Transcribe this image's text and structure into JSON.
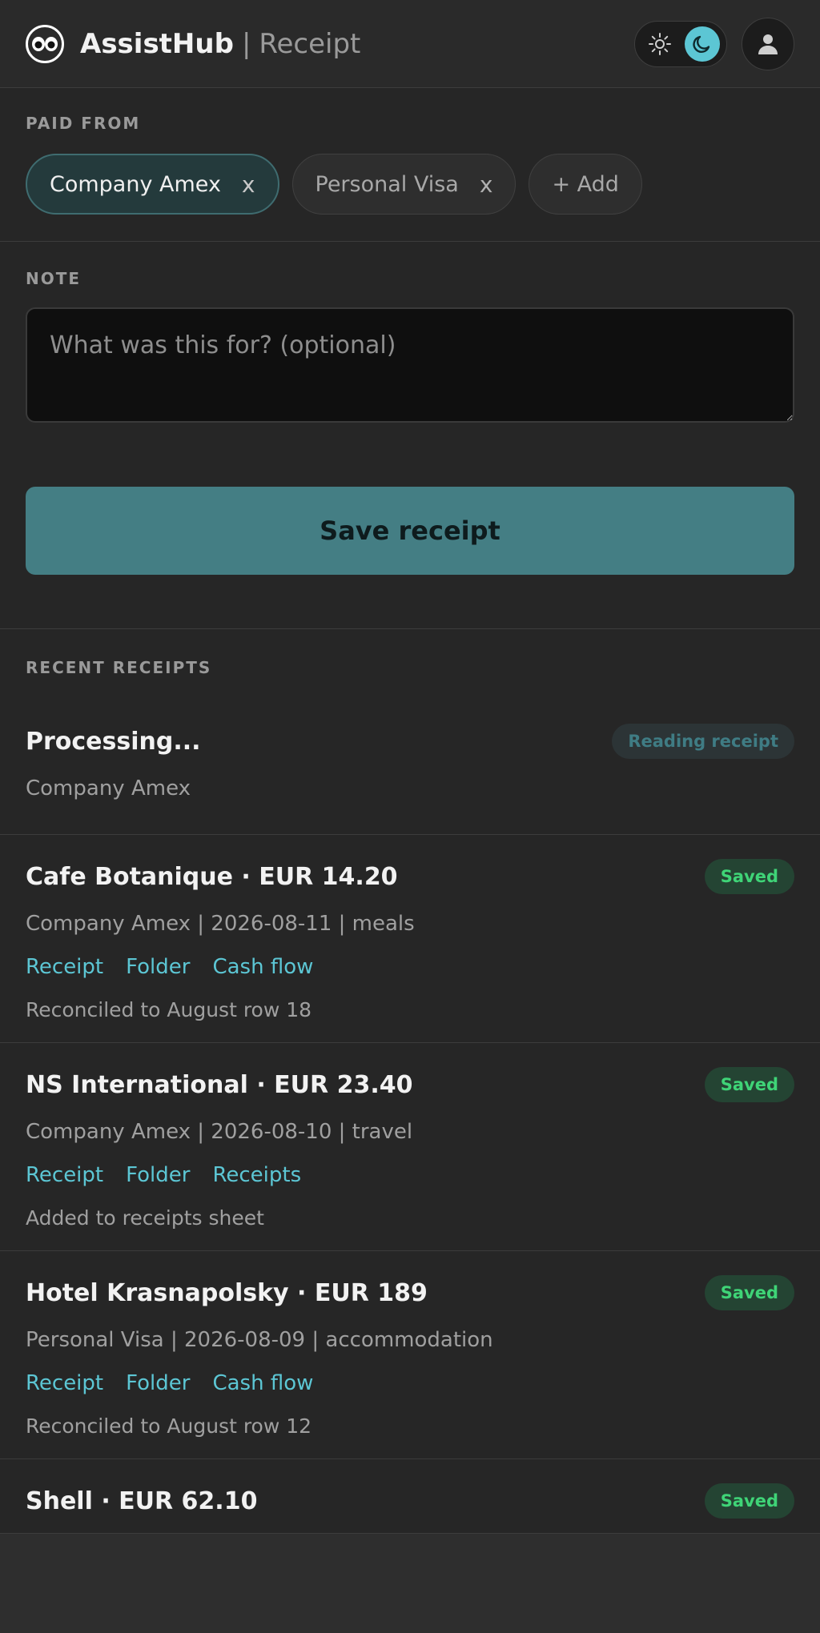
{
  "header": {
    "app_name": "AssistHub",
    "separator": "|",
    "page_name": "Receipt"
  },
  "paid_from": {
    "label": "PAID FROM",
    "chips": [
      {
        "label": "Company Amex",
        "remove": "x",
        "active": true
      },
      {
        "label": "Personal Visa",
        "remove": "x",
        "active": false
      }
    ],
    "add_label": "+ Add"
  },
  "note": {
    "label": "NOTE",
    "placeholder": "What was this for? (optional)",
    "value": ""
  },
  "save_label": "Save receipt",
  "recent": {
    "label": "RECENT RECEIPTS",
    "processing": {
      "title": "Processing...",
      "subtitle": "Company Amex",
      "badge": "Reading receipt"
    },
    "items": [
      {
        "title": "Cafe Botanique · EUR 14.20",
        "meta": "Company Amex | 2026-08-11 | meals",
        "badge": "Saved",
        "links": [
          "Receipt",
          "Folder",
          "Cash flow"
        ],
        "status": "Reconciled to August row 18"
      },
      {
        "title": "NS International · EUR 23.40",
        "meta": "Company Amex | 2026-08-10 | travel",
        "badge": "Saved",
        "links": [
          "Receipt",
          "Folder",
          "Receipts"
        ],
        "status": "Added to receipts sheet"
      },
      {
        "title": "Hotel Krasnapolsky · EUR 189",
        "meta": "Personal Visa | 2026-08-09 | accommodation",
        "badge": "Saved",
        "links": [
          "Receipt",
          "Folder",
          "Cash flow"
        ],
        "status": "Reconciled to August row 12"
      },
      {
        "title": "Shell · EUR 62.10",
        "badge": "Saved"
      }
    ]
  },
  "icons": {
    "logo": "eyes-logo-icon",
    "light_mode": "sun-icon",
    "dark_mode": "moon-icon",
    "user": "user-icon"
  },
  "colors": {
    "accent": "#5cc6d4",
    "button": "#447e84",
    "saved": "#3fd477",
    "background": "#262626"
  }
}
